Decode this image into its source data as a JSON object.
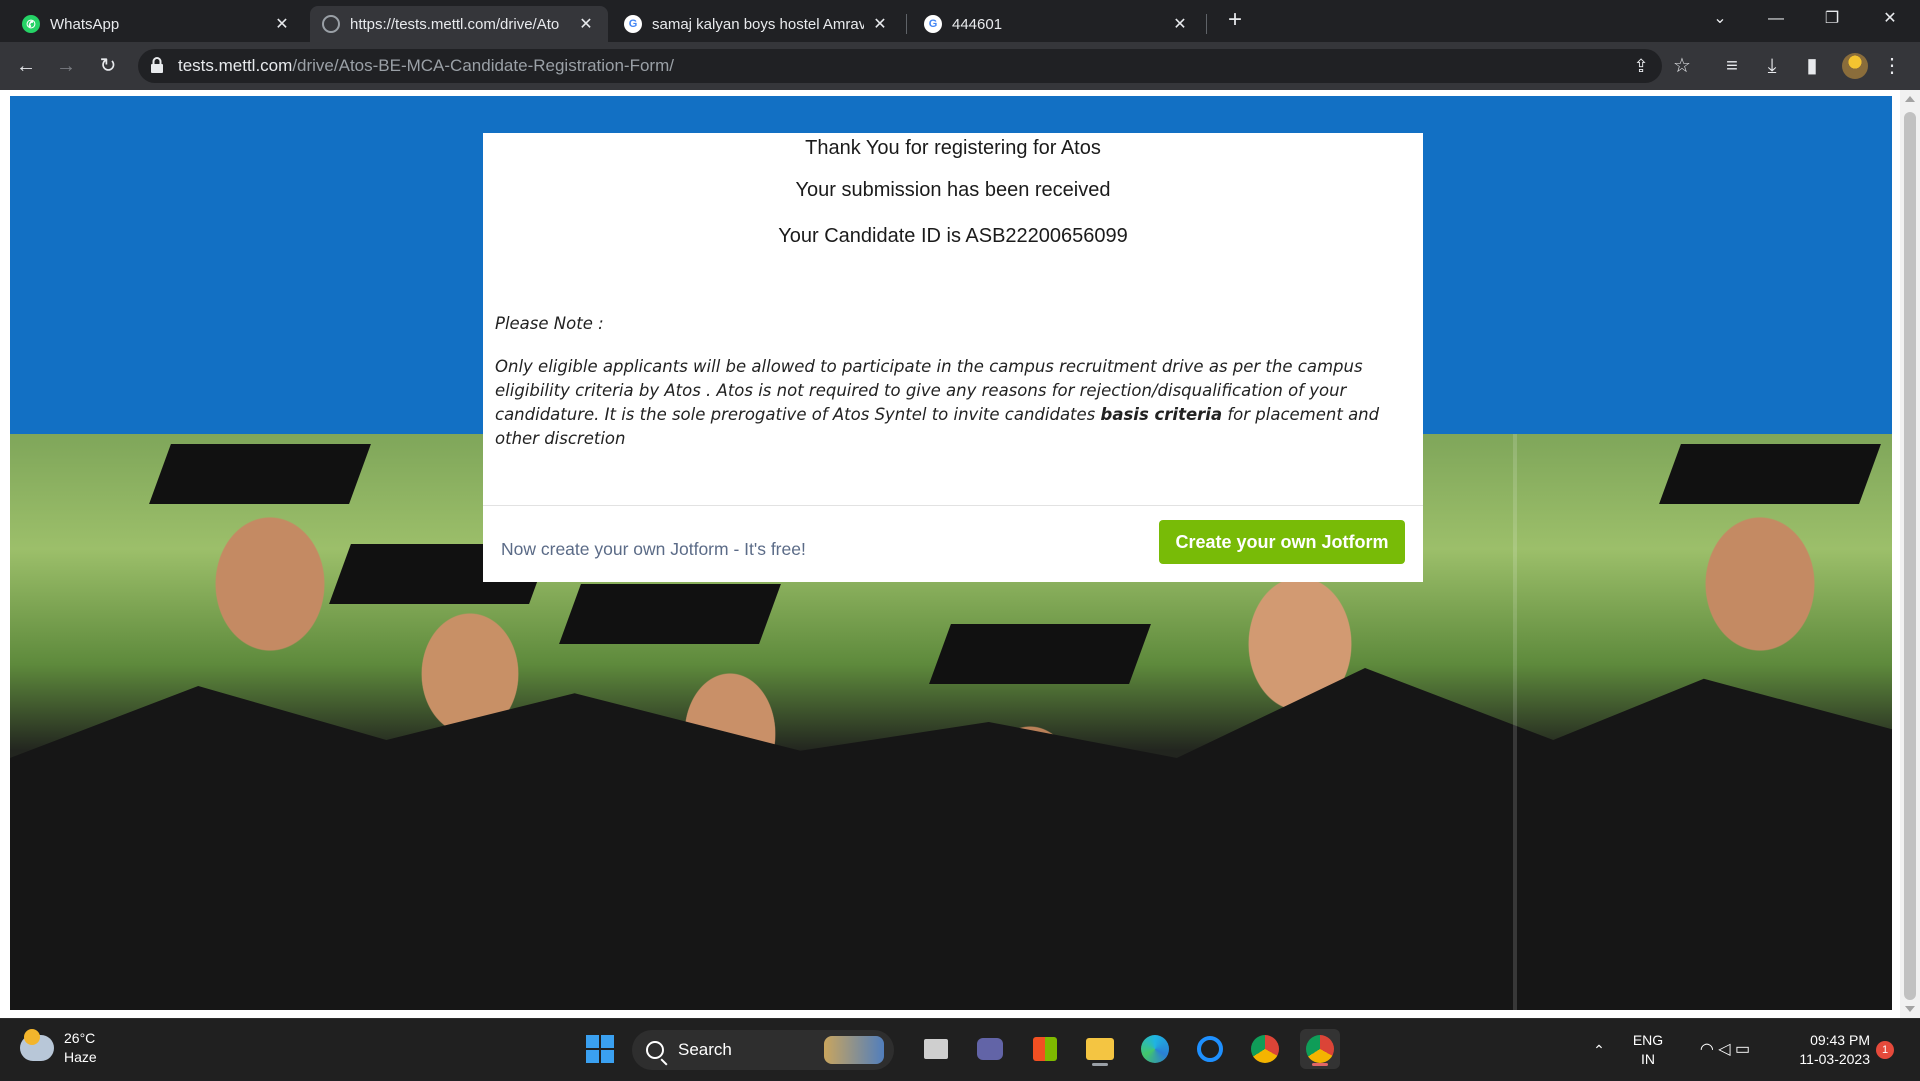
{
  "tabs": [
    {
      "title": "WhatsApp",
      "icon": "whatsapp-icon",
      "active": false
    },
    {
      "title": "https://tests.mettl.com/drive/Ato",
      "icon": "globe-icon",
      "active": true
    },
    {
      "title": "samaj kalyan boys hostel Amrava",
      "icon": "google-icon",
      "active": false
    },
    {
      "title": "444601",
      "icon": "google-icon",
      "active": false
    }
  ],
  "address_bar": {
    "host": "tests.mettl.com",
    "path": "/drive/Atos-BE-MCA-Candidate-Registration-Form/"
  },
  "card": {
    "line1": "Thank You for registering for Atos",
    "line2": "Your submission has been received",
    "line3": "Your Candidate ID is ASB22200656099",
    "note_label": "Please Note :",
    "note_before_bold": "Only eligible applicants will be allowed to participate in the campus recruitment drive as per the campus eligibility criteria by Atos . Atos is not required to give any reasons for rejection/disqualification of your candidature. It is the sole prerogative of Atos Syntel to invite candidates ",
    "note_bold": "basis criteria",
    "note_after_bold": " for placement and other discretion",
    "footer_text": "Now create your own Jotform - It's free!",
    "cta_label": "Create your own Jotform"
  },
  "taskbar": {
    "weather_temp": "26°C",
    "weather_desc": "Haze",
    "search_label": "Search",
    "lang_line1": "ENG",
    "lang_line2": "IN",
    "time": "09:43 PM",
    "date": "11-03-2023",
    "notification_count": "1"
  },
  "colors": {
    "banner_blue": "#1270c4",
    "cta_green": "#78bb07",
    "footer_text": "#5b6b87"
  }
}
